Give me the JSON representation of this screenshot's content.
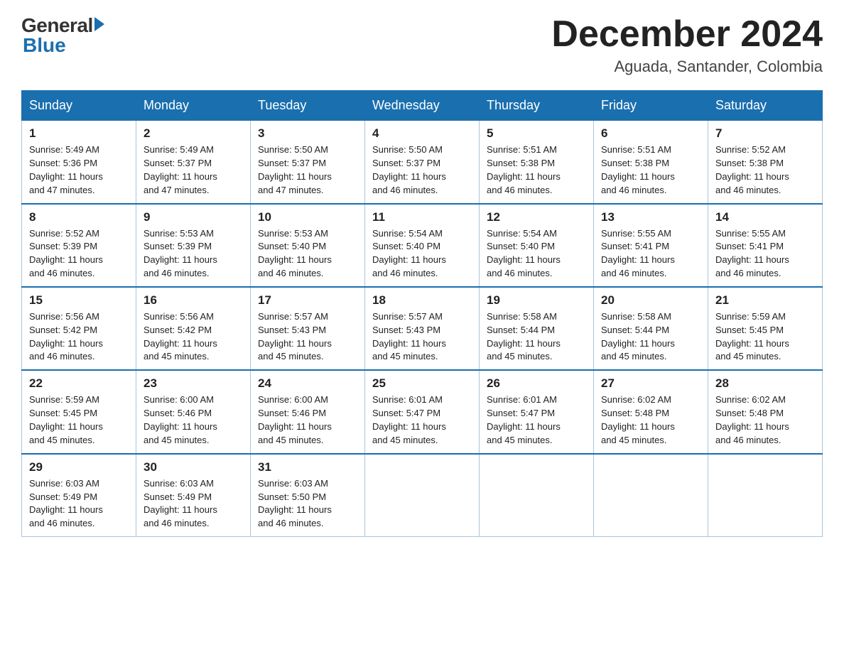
{
  "logo": {
    "general": "General",
    "blue": "Blue"
  },
  "title": "December 2024",
  "subtitle": "Aguada, Santander, Colombia",
  "days_of_week": [
    "Sunday",
    "Monday",
    "Tuesday",
    "Wednesday",
    "Thursday",
    "Friday",
    "Saturday"
  ],
  "weeks": [
    [
      {
        "day": "1",
        "sunrise": "5:49 AM",
        "sunset": "5:36 PM",
        "daylight": "11 hours and 47 minutes."
      },
      {
        "day": "2",
        "sunrise": "5:49 AM",
        "sunset": "5:37 PM",
        "daylight": "11 hours and 47 minutes."
      },
      {
        "day": "3",
        "sunrise": "5:50 AM",
        "sunset": "5:37 PM",
        "daylight": "11 hours and 47 minutes."
      },
      {
        "day": "4",
        "sunrise": "5:50 AM",
        "sunset": "5:37 PM",
        "daylight": "11 hours and 46 minutes."
      },
      {
        "day": "5",
        "sunrise": "5:51 AM",
        "sunset": "5:38 PM",
        "daylight": "11 hours and 46 minutes."
      },
      {
        "day": "6",
        "sunrise": "5:51 AM",
        "sunset": "5:38 PM",
        "daylight": "11 hours and 46 minutes."
      },
      {
        "day": "7",
        "sunrise": "5:52 AM",
        "sunset": "5:38 PM",
        "daylight": "11 hours and 46 minutes."
      }
    ],
    [
      {
        "day": "8",
        "sunrise": "5:52 AM",
        "sunset": "5:39 PM",
        "daylight": "11 hours and 46 minutes."
      },
      {
        "day": "9",
        "sunrise": "5:53 AM",
        "sunset": "5:39 PM",
        "daylight": "11 hours and 46 minutes."
      },
      {
        "day": "10",
        "sunrise": "5:53 AM",
        "sunset": "5:40 PM",
        "daylight": "11 hours and 46 minutes."
      },
      {
        "day": "11",
        "sunrise": "5:54 AM",
        "sunset": "5:40 PM",
        "daylight": "11 hours and 46 minutes."
      },
      {
        "day": "12",
        "sunrise": "5:54 AM",
        "sunset": "5:40 PM",
        "daylight": "11 hours and 46 minutes."
      },
      {
        "day": "13",
        "sunrise": "5:55 AM",
        "sunset": "5:41 PM",
        "daylight": "11 hours and 46 minutes."
      },
      {
        "day": "14",
        "sunrise": "5:55 AM",
        "sunset": "5:41 PM",
        "daylight": "11 hours and 46 minutes."
      }
    ],
    [
      {
        "day": "15",
        "sunrise": "5:56 AM",
        "sunset": "5:42 PM",
        "daylight": "11 hours and 46 minutes."
      },
      {
        "day": "16",
        "sunrise": "5:56 AM",
        "sunset": "5:42 PM",
        "daylight": "11 hours and 45 minutes."
      },
      {
        "day": "17",
        "sunrise": "5:57 AM",
        "sunset": "5:43 PM",
        "daylight": "11 hours and 45 minutes."
      },
      {
        "day": "18",
        "sunrise": "5:57 AM",
        "sunset": "5:43 PM",
        "daylight": "11 hours and 45 minutes."
      },
      {
        "day": "19",
        "sunrise": "5:58 AM",
        "sunset": "5:44 PM",
        "daylight": "11 hours and 45 minutes."
      },
      {
        "day": "20",
        "sunrise": "5:58 AM",
        "sunset": "5:44 PM",
        "daylight": "11 hours and 45 minutes."
      },
      {
        "day": "21",
        "sunrise": "5:59 AM",
        "sunset": "5:45 PM",
        "daylight": "11 hours and 45 minutes."
      }
    ],
    [
      {
        "day": "22",
        "sunrise": "5:59 AM",
        "sunset": "5:45 PM",
        "daylight": "11 hours and 45 minutes."
      },
      {
        "day": "23",
        "sunrise": "6:00 AM",
        "sunset": "5:46 PM",
        "daylight": "11 hours and 45 minutes."
      },
      {
        "day": "24",
        "sunrise": "6:00 AM",
        "sunset": "5:46 PM",
        "daylight": "11 hours and 45 minutes."
      },
      {
        "day": "25",
        "sunrise": "6:01 AM",
        "sunset": "5:47 PM",
        "daylight": "11 hours and 45 minutes."
      },
      {
        "day": "26",
        "sunrise": "6:01 AM",
        "sunset": "5:47 PM",
        "daylight": "11 hours and 45 minutes."
      },
      {
        "day": "27",
        "sunrise": "6:02 AM",
        "sunset": "5:48 PM",
        "daylight": "11 hours and 45 minutes."
      },
      {
        "day": "28",
        "sunrise": "6:02 AM",
        "sunset": "5:48 PM",
        "daylight": "11 hours and 46 minutes."
      }
    ],
    [
      {
        "day": "29",
        "sunrise": "6:03 AM",
        "sunset": "5:49 PM",
        "daylight": "11 hours and 46 minutes."
      },
      {
        "day": "30",
        "sunrise": "6:03 AM",
        "sunset": "5:49 PM",
        "daylight": "11 hours and 46 minutes."
      },
      {
        "day": "31",
        "sunrise": "6:03 AM",
        "sunset": "5:50 PM",
        "daylight": "11 hours and 46 minutes."
      },
      null,
      null,
      null,
      null
    ]
  ],
  "labels": {
    "sunrise": "Sunrise:",
    "sunset": "Sunset:",
    "daylight": "Daylight:"
  }
}
